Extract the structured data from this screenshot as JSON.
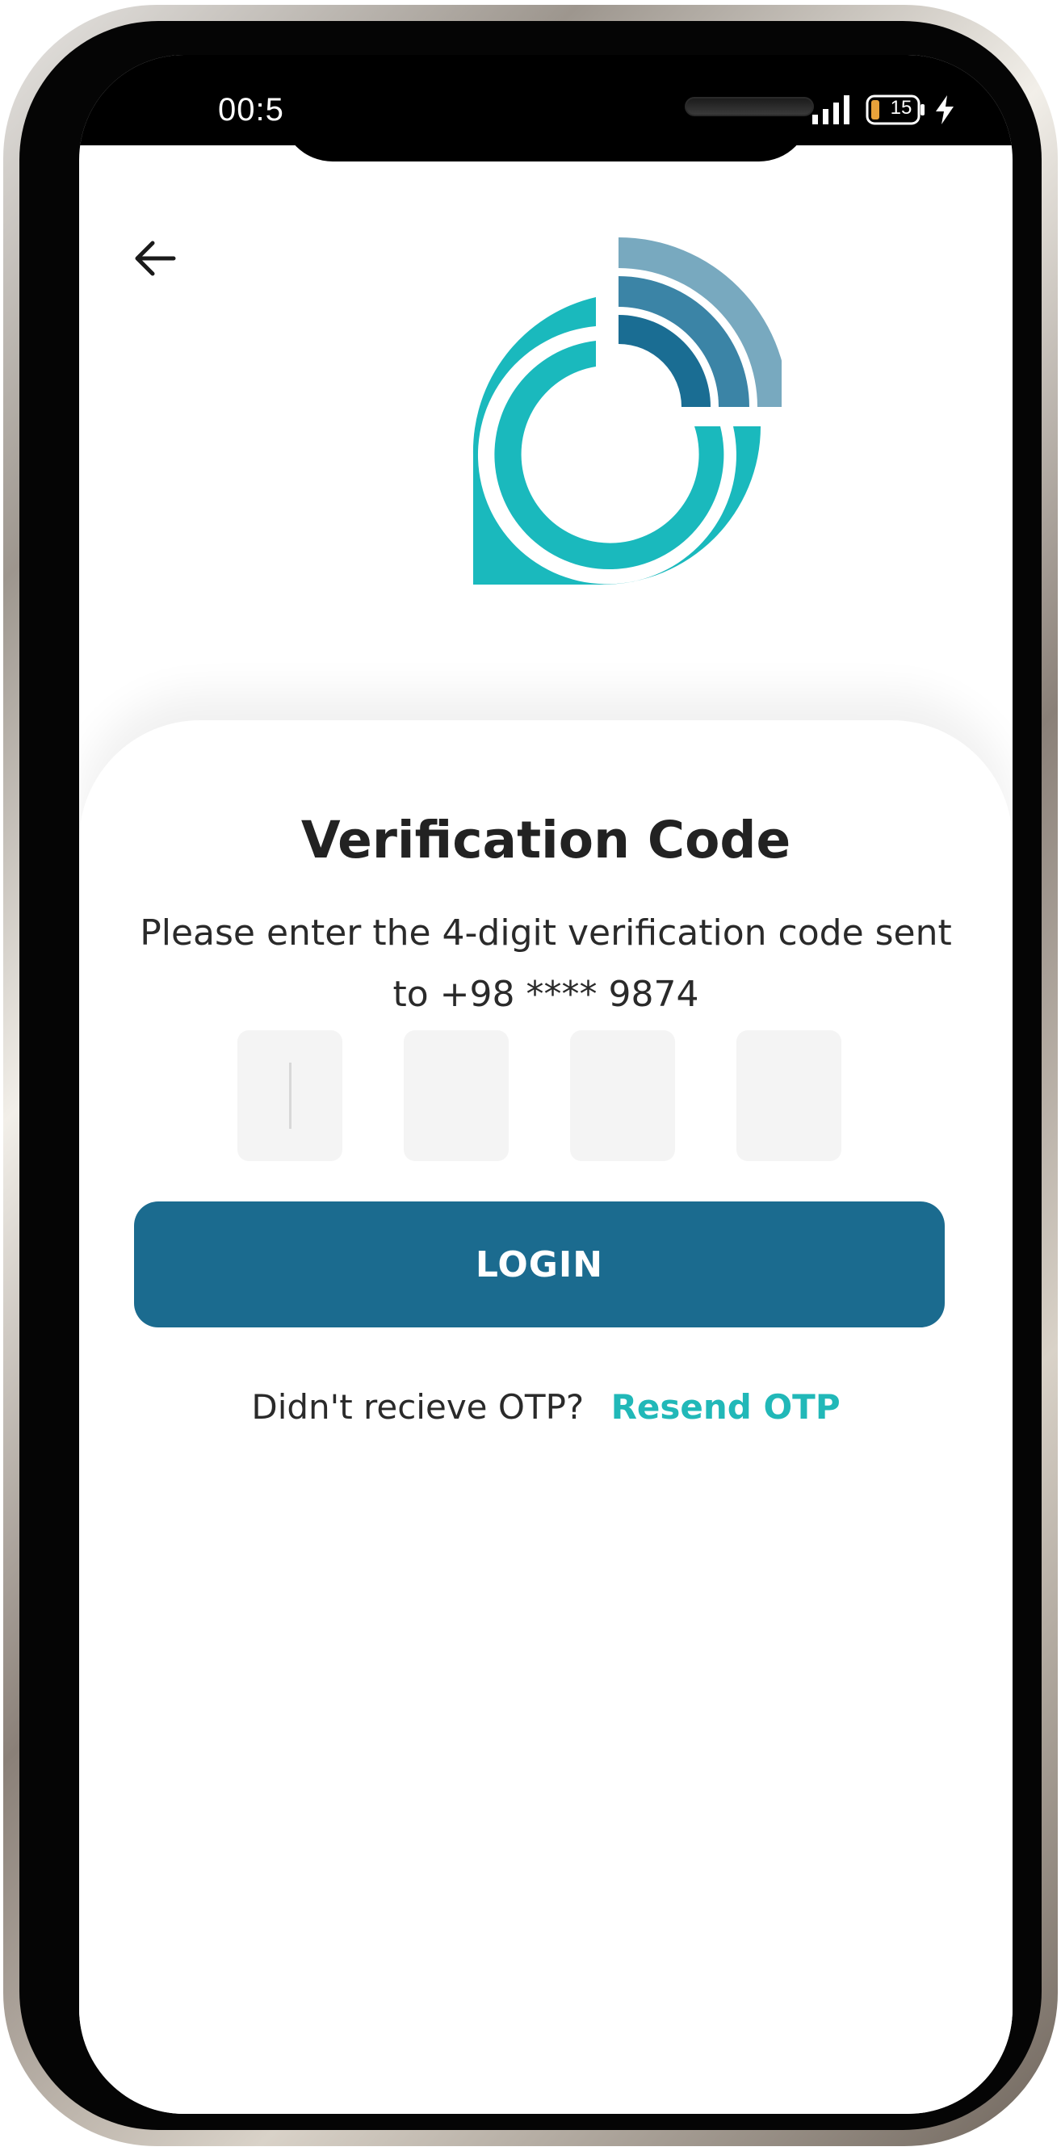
{
  "status_bar": {
    "time": "00:5",
    "battery": "15",
    "signal_icon": "signal-bars-icon",
    "charge_icon": "charging-bolt-icon"
  },
  "header": {
    "back_icon": "arrow-left-icon",
    "logo_icon": "signal-location-pin-logo"
  },
  "verification": {
    "title": "Verification Code",
    "subtitle": "Please enter the 4-digit verification code sent to +98 **** 9874",
    "otp_fields": [
      "",
      "",
      "",
      ""
    ],
    "login_label": "LOGIN",
    "resend_prompt": "Didn't recieve OTP?",
    "resend_label": "Resend OTP"
  },
  "colors": {
    "primary": "#1b6b8f",
    "accent": "#21b8b8",
    "logo_teal": "#1ab9bd",
    "logo_light_blue": "#78a9bf",
    "logo_mid_blue": "#3b84a6",
    "logo_dark_blue": "#1a6d93"
  }
}
